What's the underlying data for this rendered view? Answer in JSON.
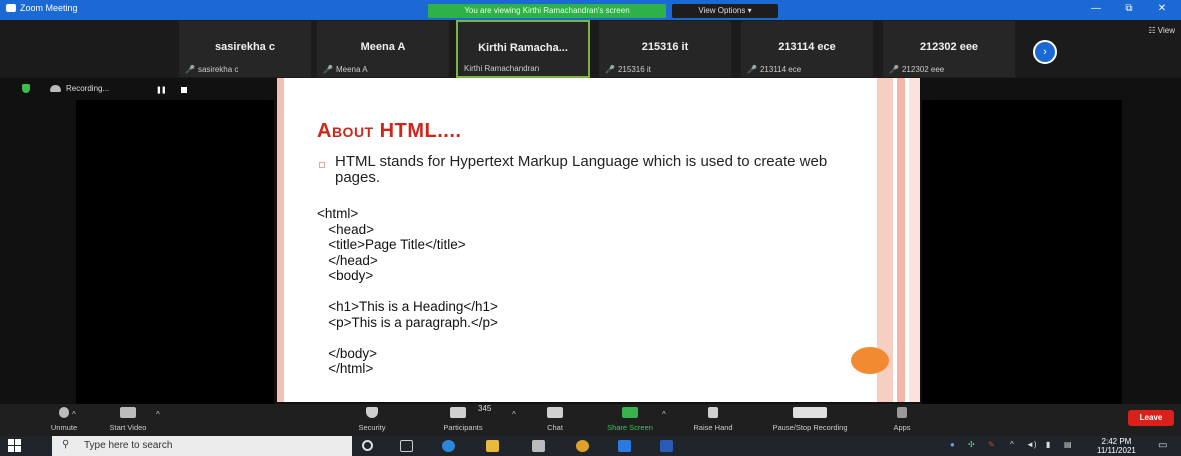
{
  "titlebar": {
    "app_title": "Zoom Meeting",
    "viewing_banner": "You are viewing Kirthi Ramachandran's screen",
    "view_options": "View Options ▾",
    "minimize": "—",
    "maximize": "⧉",
    "close": "✕"
  },
  "participants": [
    {
      "display": "sasirekha c",
      "name": "sasirekha c",
      "muted": true
    },
    {
      "display": "Meena A",
      "name": "Meena A",
      "muted": true
    },
    {
      "display": "Kirthi Ramacha...",
      "name": "Kirthi Ramachandran",
      "muted": false,
      "active": true
    },
    {
      "display": "215316 it",
      "name": "215316 it",
      "muted": true
    },
    {
      "display": "213114 ece",
      "name": "213114 ece",
      "muted": true
    },
    {
      "display": "212302 eee",
      "name": "212302 eee",
      "muted": true
    }
  ],
  "strip": {
    "next": "›",
    "view": "☷ View"
  },
  "recording": {
    "label": "Recording...",
    "pause": "❚❚"
  },
  "slide": {
    "title": "About HTML....",
    "bullet": "HTML  stands for Hypertext Markup Language which is used to create web pages.",
    "code": "<html>\n   <head>\n   <title>Page Title</title>\n   </head>\n   <body>\n\n   <h1>This is a Heading</h1>\n   <p>This is a paragraph.</p>\n\n   </body>\n   </html>"
  },
  "controls": {
    "unmute": "Unmute",
    "start_video": "Start Video",
    "security": "Security",
    "participants": "Participants",
    "participant_count": "345",
    "chat": "Chat",
    "share_screen": "Share Screen",
    "raise_hand": "Raise Hand",
    "pause_recording": "Pause/Stop Recording",
    "apps": "Apps",
    "leave": "Leave"
  },
  "taskbar": {
    "search_placeholder": "Type here to search",
    "time": "2:42 PM",
    "date": "11/11/2021"
  },
  "colors": {
    "zoom_blue": "#1a69d4",
    "banner_green": "#2fb14a",
    "slide_title_red": "#d0261a",
    "leave_red": "#d9201a",
    "accent_orange": "#f28a32"
  }
}
